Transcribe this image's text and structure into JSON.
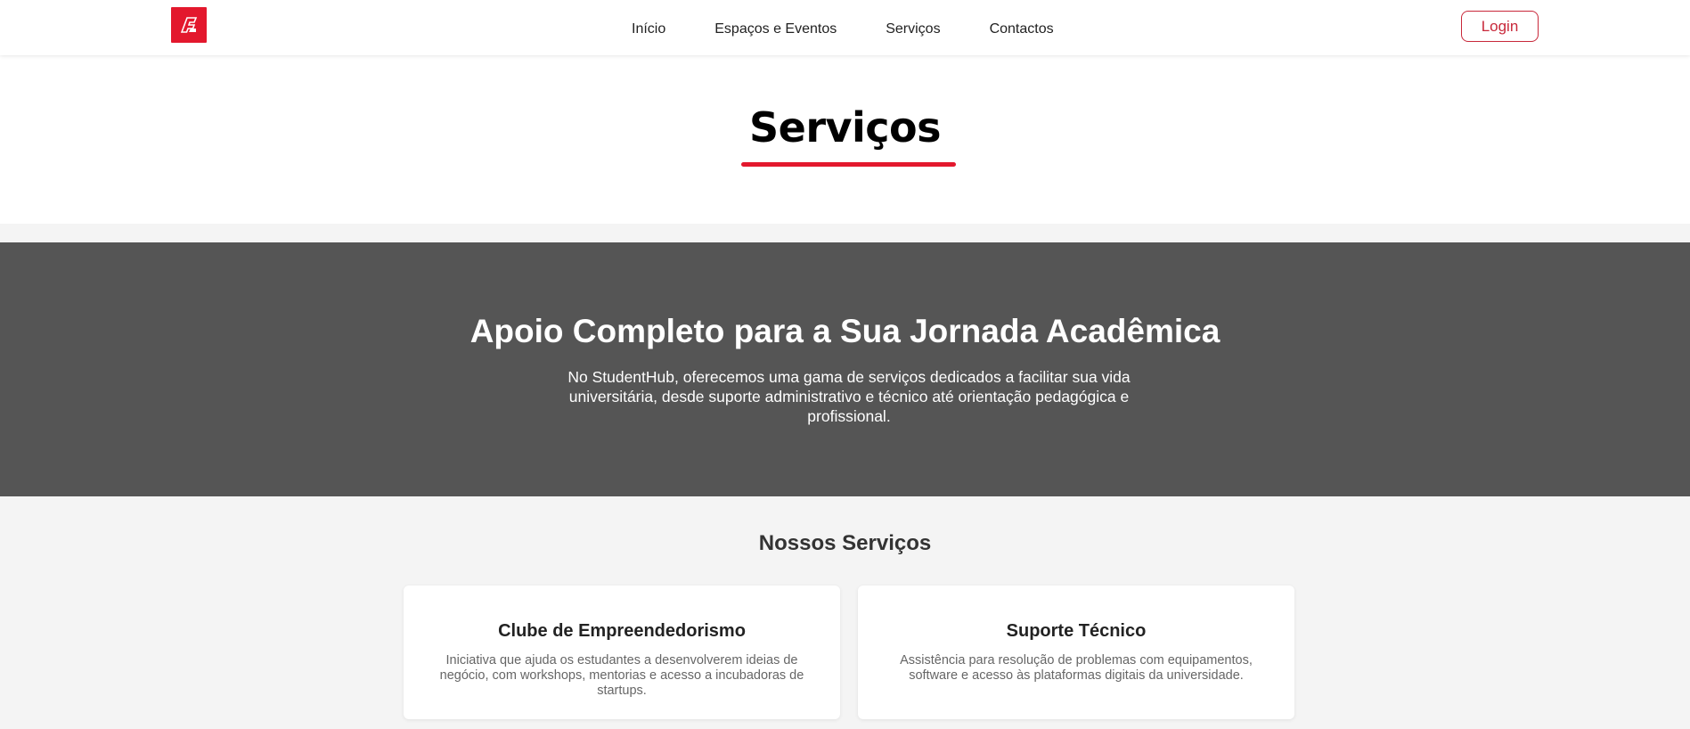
{
  "brand": {
    "logo_icon": "brand-logo-icon",
    "accent_color": "#e3182d"
  },
  "nav": {
    "links": [
      {
        "label": "Início"
      },
      {
        "label": "Espaços e Eventos"
      },
      {
        "label": "Serviços"
      },
      {
        "label": "Contactos"
      }
    ],
    "login_label": "Login"
  },
  "page": {
    "title": "Serviços"
  },
  "hero": {
    "title": "Apoio Completo para a Sua Jornada Acadêmica",
    "text": "No StudentHub, oferecemos uma gama de serviços dedicados a facilitar sua vida universitária, desde suporte administrativo e técnico até orientação pedagógica e profissional.",
    "background_color": "#555555"
  },
  "services": {
    "heading": "Nossos Serviços",
    "cards": [
      {
        "title": "Clube de Empreendedorismo",
        "text": "Iniciativa que ajuda os estudantes a desenvolverem ideias de negócio, com workshops, mentorias e acesso a incubadoras de startups."
      },
      {
        "title": "Suporte Técnico",
        "text": "Assistência para resolução de problemas com equipamentos, software e acesso às plataformas digitais da universidade."
      }
    ]
  }
}
